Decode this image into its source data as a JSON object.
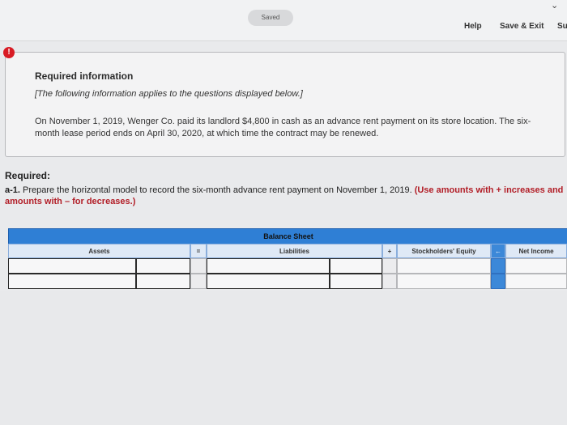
{
  "topbar": {
    "saved_label": "Saved",
    "help_label": "Help",
    "save_exit_label": "Save & Exit",
    "submit_partial": "Su"
  },
  "alert_icon": "!",
  "info": {
    "title": "Required information",
    "subtitle": "[The following information applies to the questions displayed below.]",
    "body": "On November 1, 2019, Wenger Co. paid its landlord $4,800 in cash as an advance rent payment on its store location. The six-month lease period ends on April 30, 2020, at which time the contract may be renewed."
  },
  "required": {
    "label": "Required:",
    "question_num": "a-1.",
    "question_text": " Prepare the horizontal model to record the six-month advance rent payment on November 1, 2019. ",
    "instruction": "(Use amounts with + increases and amounts with – for decreases.)"
  },
  "table": {
    "balance_sheet": "Balance Sheet",
    "assets": "Assets",
    "equals": "=",
    "liabilities": "Liabilities",
    "plus": "+",
    "equity": "Stockholders' Equity",
    "arrow": "←",
    "net_income": "Net Income"
  },
  "colors": {
    "header_blue": "#2f7fd5",
    "alert_red": "#d81b24",
    "instruction_red": "#b21e27"
  }
}
